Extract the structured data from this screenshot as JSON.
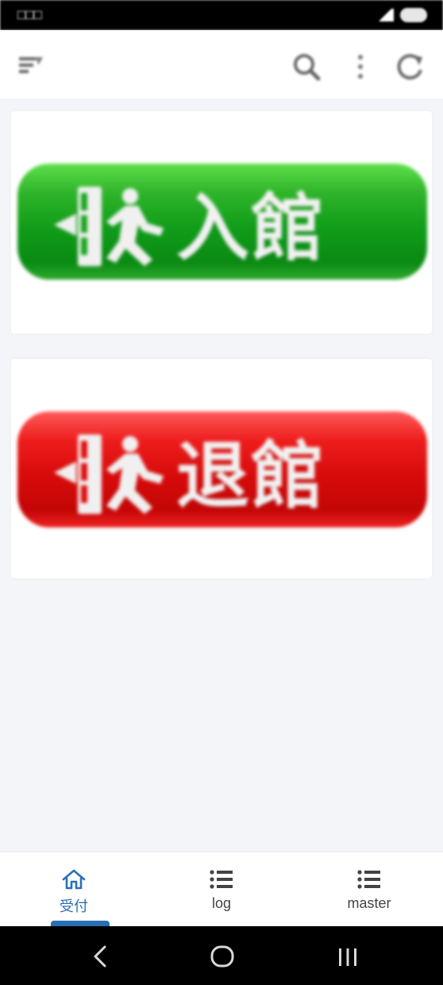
{
  "status_bar": {
    "left_text": "□□□",
    "icons": [
      "signal-icon",
      "battery-icon"
    ]
  },
  "toolbar": {
    "icons": [
      "menu-icon",
      "search-icon",
      "more-vert-icon",
      "refresh-icon"
    ]
  },
  "actions": {
    "check_in": {
      "label": "入館",
      "color": "#1aa520",
      "icon": "emergency-exit-pictogram-icon"
    },
    "check_out": {
      "label": "退館",
      "color": "#e00d0d",
      "icon": "emergency-exit-pictogram-icon"
    }
  },
  "bottom_nav": {
    "items": [
      {
        "label": "受付",
        "icon": "home-icon",
        "active": true
      },
      {
        "label": "log",
        "icon": "list-icon",
        "active": false
      },
      {
        "label": "master",
        "icon": "list-icon",
        "active": false
      }
    ],
    "active_color": "#2a6fb5"
  },
  "system_nav": {
    "icons": [
      "back-icon",
      "home-circle-icon",
      "recents-icon"
    ]
  }
}
